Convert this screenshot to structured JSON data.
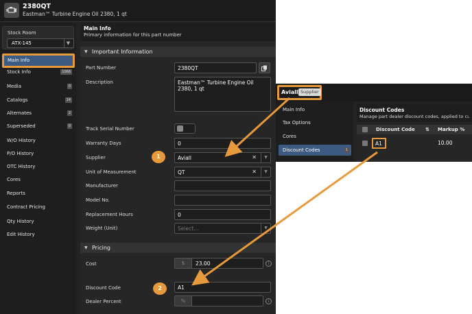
{
  "header": {
    "part_code": "2380QT",
    "part_subtitle": "Eastman™ Turbine Engine Oil 2380, 1 qt",
    "icon": "engine-icon"
  },
  "sidebar": {
    "stock_room_label": "Stock Room",
    "stock_room_value": "ATX-145",
    "items": [
      {
        "label": "Main Info",
        "active": true
      },
      {
        "label": "Stock Info",
        "badge": "1068"
      },
      {
        "label": "Media",
        "badge": "0"
      },
      {
        "label": "Catalogs",
        "badge": "14"
      },
      {
        "label": "Alternates",
        "badge": "2"
      },
      {
        "label": "Superseded",
        "badge": "0"
      },
      {
        "label": "W/O History"
      },
      {
        "label": "P/O History"
      },
      {
        "label": "OTC History"
      },
      {
        "label": "Cores"
      },
      {
        "label": "Reports"
      },
      {
        "label": "Contract Pricing"
      },
      {
        "label": "Qty History"
      },
      {
        "label": "Edit History"
      }
    ]
  },
  "main": {
    "title": "Main Info",
    "subtitle": "Primary information for this part number",
    "important_section": "Important Information",
    "pricing_section": "Pricing",
    "fields": {
      "part_number_label": "Part Number",
      "part_number_value": "2380QT",
      "description_label": "Description",
      "description_value": "Eastman™ Turbine Engine Oil 2380, 1 qt",
      "track_serial_label": "Track Serial Number",
      "warranty_label": "Warranty Days",
      "warranty_value": "0",
      "supplier_label": "Supplier",
      "supplier_value": "Aviall",
      "uom_label": "Unit of Measurement",
      "uom_value": "QT",
      "manufacturer_label": "Manufacturer",
      "model_label": "Model No.",
      "replacement_label": "Replacement Hours",
      "replacement_value": "0",
      "weight_label": "Weight (Unit)",
      "weight_placeholder": "Select...",
      "cost_label": "Cost",
      "cost_prefix": "$",
      "cost_value": "23.00",
      "discount_label": "Discount Code",
      "discount_value": "A1",
      "dealer_percent_label": "Dealer Percent",
      "dealer_percent_prefix": "%"
    },
    "step1": "1",
    "step2": "2"
  },
  "popup": {
    "vendor_name": "Aviall",
    "vendor_tag": "Supplier",
    "nav": [
      {
        "label": "Main Info"
      },
      {
        "label": "Tax Options"
      },
      {
        "label": "Cores"
      },
      {
        "label": "Discount Codes",
        "badge": "1",
        "active": true
      }
    ],
    "title": "Discount Codes",
    "subtitle": "Manage part dealer discount codes, applied to cus",
    "col_code": "Discount Code",
    "col_sort_icon": "⇅",
    "col_markup": "Markup %",
    "row_code": "A1",
    "row_markup": "10.00"
  },
  "colors": {
    "accent_orange": "#e79a3c",
    "active_blue": "#3d5a82",
    "background_dark": "#232323"
  }
}
